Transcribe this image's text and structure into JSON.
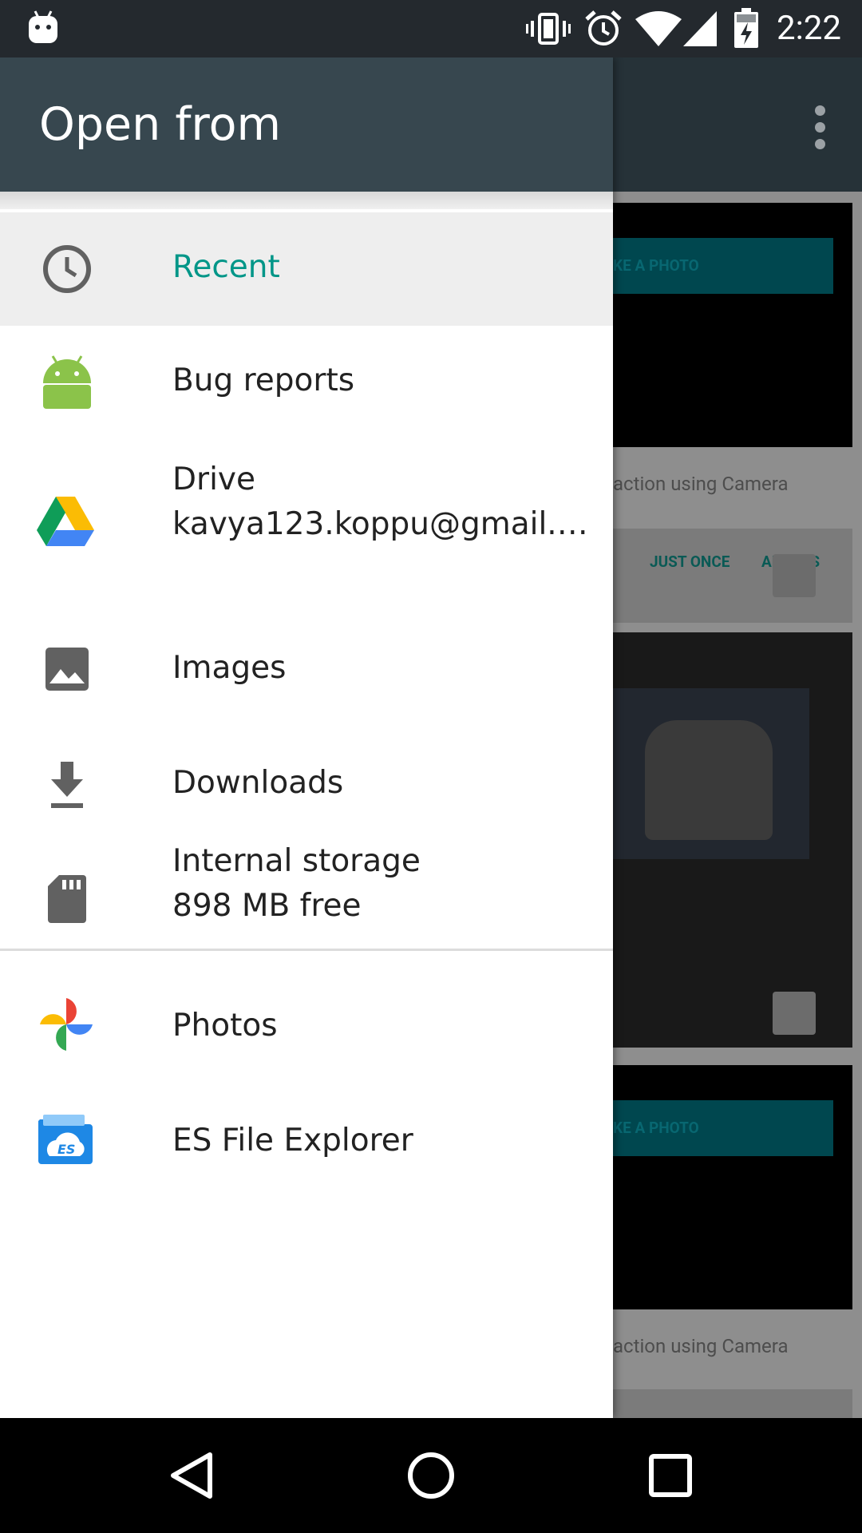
{
  "status_bar": {
    "time": "2:22",
    "icons": [
      "android-notification-icon",
      "vibrate-icon",
      "alarm-icon",
      "wifi-icon",
      "signal-icon",
      "battery-charging-icon"
    ]
  },
  "drawer": {
    "title": "Open from",
    "roots": [
      {
        "title": "Recent",
        "subtitle": "",
        "icon": "clock-icon",
        "selected": true
      },
      {
        "title": "Bug reports",
        "subtitle": "",
        "icon": "android-icon"
      },
      {
        "title": "Drive",
        "subtitle": "kavya123.koppu@gmail.…",
        "icon": "google-drive-icon"
      },
      {
        "title": "Images",
        "subtitle": "",
        "icon": "image-icon"
      },
      {
        "title": "Downloads",
        "subtitle": "",
        "icon": "download-icon"
      },
      {
        "title": "Internal storage",
        "subtitle": "898 MB free",
        "icon": "sd-card-icon"
      }
    ],
    "apps": [
      {
        "title": "Photos",
        "icon": "google-photos-icon"
      },
      {
        "title": "ES File Explorer",
        "icon": "es-file-explorer-icon"
      }
    ]
  },
  "background": {
    "cta_label_1": "KE A PHOTO",
    "caption_1": "action using Camera",
    "just_once": "JUST ONCE",
    "always": "ALWAYS",
    "cta_label_2": "KE A PHOTO",
    "caption_2": "action using Camera"
  },
  "nav_bar": {
    "buttons": [
      "back-icon",
      "home-icon",
      "recents-icon"
    ]
  }
}
